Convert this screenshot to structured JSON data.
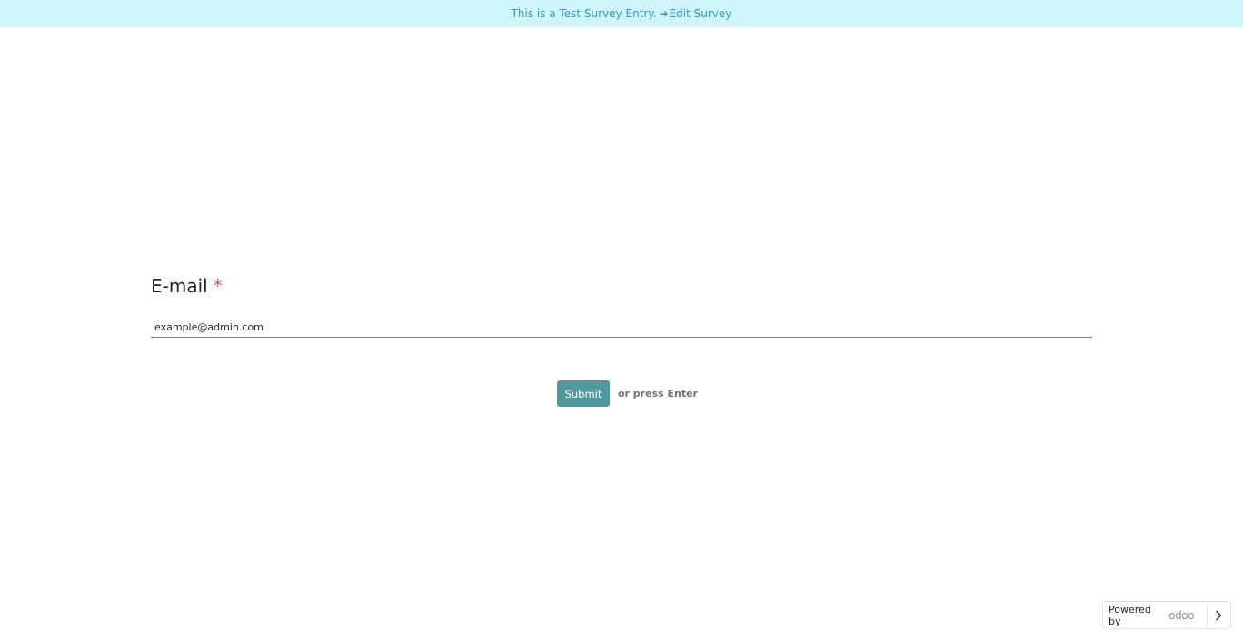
{
  "banner": {
    "text": "This is a Test Survey Entry.",
    "arrow": "➔",
    "link_label": "Edit Survey"
  },
  "question": {
    "title": "E-mail",
    "required_mark": "*",
    "answer_value": "example@admin.com"
  },
  "actions": {
    "submit_label": "Submit",
    "hint": "or press Enter"
  },
  "footer": {
    "powered_by": "Powered by",
    "brand": "odoo"
  },
  "colors": {
    "banner_bg": "#cff4fc",
    "accent": "#51989c",
    "required": "#d9534f"
  }
}
